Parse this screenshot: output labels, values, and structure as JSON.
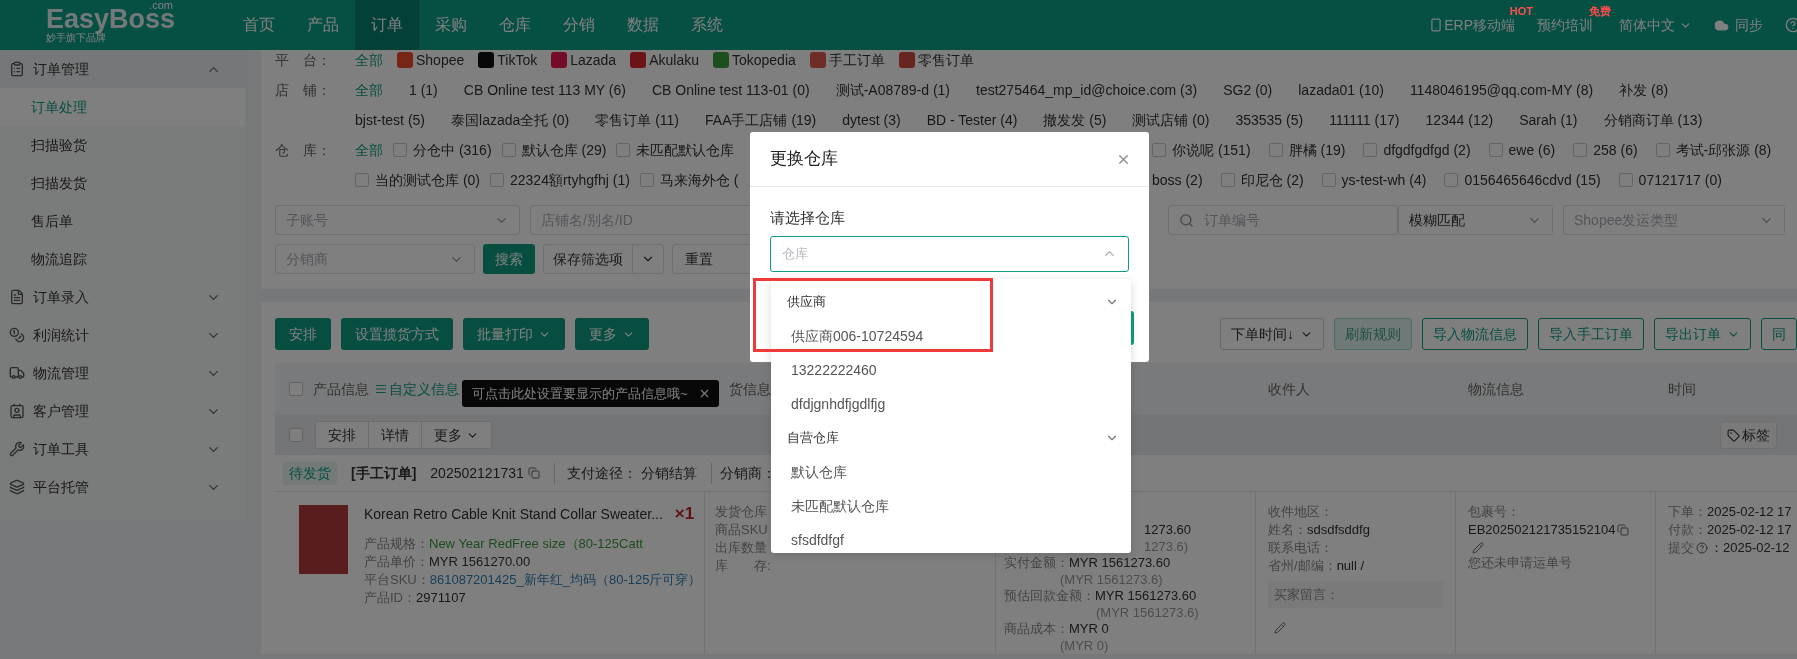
{
  "header": {
    "logo": "EasyBoss",
    "logo_domain": ".com",
    "tagline": "妙手旗下品牌",
    "nav": [
      {
        "label": "首页",
        "selected": false
      },
      {
        "label": "产品",
        "selected": false
      },
      {
        "label": "订单",
        "selected": true
      },
      {
        "label": "采购",
        "selected": false
      },
      {
        "label": "仓库",
        "selected": false
      },
      {
        "label": "分销",
        "selected": false
      },
      {
        "label": "数据",
        "selected": false
      },
      {
        "label": "系统",
        "selected": false
      }
    ],
    "tools": [
      {
        "kind": "mobile",
        "label": "ERP移动端",
        "badge": "HOT"
      },
      {
        "kind": "training",
        "label": "预约培训",
        "badge": "免费"
      },
      {
        "kind": "language",
        "label": "简体中文"
      },
      {
        "kind": "sync",
        "label": "同步"
      },
      {
        "kind": "help"
      }
    ]
  },
  "sidebar": [
    {
      "label": "订单管理",
      "expanded": true,
      "children": [
        {
          "label": "订单处理",
          "selected": true
        },
        {
          "label": "扫描验货",
          "selected": false
        },
        {
          "label": "扫描发货",
          "selected": false
        },
        {
          "label": "售后单",
          "selected": false
        },
        {
          "label": "物流追踪",
          "selected": false
        }
      ]
    },
    {
      "label": "订单录入",
      "expanded": false
    },
    {
      "label": "利润统计",
      "expanded": false
    },
    {
      "label": "物流管理",
      "expanded": false
    },
    {
      "label": "客户管理",
      "expanded": false
    },
    {
      "label": "订单工具",
      "expanded": false
    },
    {
      "label": "平台托管",
      "expanded": false
    }
  ],
  "filters": {
    "platform": {
      "label": "平　台：",
      "options": [
        {
          "label": "全部",
          "selected": true
        },
        {
          "label": "Shopee",
          "selected": false
        },
        {
          "label": "TikTok",
          "selected": false
        },
        {
          "label": "Lazada",
          "selected": false
        },
        {
          "label": "Akulaku",
          "selected": false
        },
        {
          "label": "Tokopedia",
          "selected": false
        },
        {
          "label": "手工订单",
          "selected": false
        },
        {
          "label": "零售订单",
          "selected": false
        }
      ]
    },
    "shop": {
      "label": "店　铺：",
      "options": [
        {
          "label": "全部",
          "selected": true
        },
        {
          "label": "1 (1)",
          "selected": false
        },
        {
          "label": "CB Online test 113 MY (6)",
          "selected": false
        },
        {
          "label": "CB Online test 113-01 (0)",
          "selected": false
        },
        {
          "label": "测试-A08789-d (1)",
          "selected": false
        },
        {
          "label": "test275464_mp_id@choice.com (3)",
          "selected": false
        },
        {
          "label": "SG2 (0)",
          "selected": false
        },
        {
          "label": "lazada01 (10)",
          "selected": false
        },
        {
          "label": "1148046195@qq.com-MY (8)",
          "selected": false
        },
        {
          "label": "补发 (8)",
          "selected": false
        },
        {
          "label": "bjst-test (5)",
          "selected": false
        },
        {
          "label": "泰国lazada全托 (0)",
          "selected": false
        },
        {
          "label": "零售订单 (11)",
          "selected": false
        },
        {
          "label": "FAA手工店铺 (19)",
          "selected": false
        },
        {
          "label": "dytest (3)",
          "selected": false
        },
        {
          "label": "BD - Tester (4)",
          "selected": false
        },
        {
          "label": "撤发发 (5)",
          "selected": false
        },
        {
          "label": "测试店铺 (0)",
          "selected": false
        },
        {
          "label": "353535 (5)",
          "selected": false
        },
        {
          "label": "111111 (17)",
          "selected": false
        },
        {
          "label": "12344 (12)",
          "selected": false
        },
        {
          "label": "Sarah (1)",
          "selected": false
        },
        {
          "label": "分销商订单 (13)",
          "selected": false
        }
      ]
    },
    "warehouse": {
      "label": "仓　库：",
      "all": {
        "label": "全部",
        "selected": true
      },
      "rows": [
        {
          "left": [
            {
              "label": "分仓中 (316)",
              "checked": false
            },
            {
              "label": "默认仓库 (29)",
              "checked": false
            },
            {
              "label": "未匹配默认仓库",
              "checked": false
            }
          ],
          "right": [
            {
              "label": "你说呢 (151)",
              "checked": false
            },
            {
              "label": "胖橘 (19)",
              "checked": false
            },
            {
              "label": "dfgdfgdfgd (2)",
              "checked": false
            },
            {
              "label": "ewe (6)",
              "checked": false
            },
            {
              "label": "258 (6)",
              "checked": false
            },
            {
              "label": "考试-邱张源 (8)",
              "checked": false
            }
          ]
        },
        {
          "left": [
            {
              "label": "当的测试仓库 (0)",
              "checked": false
            },
            {
              "label": "22324額rtyhgfhj (1)",
              "checked": false
            },
            {
              "label": "马来海外仓 (",
              "checked": false
            }
          ],
          "right_cut": "boss (2)",
          "right": [
            {
              "label": "印尼仓 (2)",
              "checked": false
            },
            {
              "label": "ys-test-wh (4)",
              "checked": false
            },
            {
              "label": "0156465646cdvd (15)",
              "checked": false
            },
            {
              "label": "07121717 (0)",
              "checked": false
            }
          ]
        }
      ]
    },
    "fields_left": [
      {
        "kind": "select",
        "placeholder": "子账号"
      },
      {
        "kind": "input",
        "placeholder": "店铺名/别名/ID"
      }
    ],
    "fields_right": [
      {
        "kind": "search",
        "placeholder": "订单编号"
      },
      {
        "kind": "select",
        "value": "模糊匹配"
      },
      {
        "kind": "select",
        "placeholder": "Shopee发运类型"
      }
    ],
    "distributor": {
      "placeholder": "分销商"
    },
    "search_button": "搜索",
    "save_button": "保存筛选项",
    "reset_button": "重置"
  },
  "toolbar": {
    "left": [
      {
        "label": "安排",
        "caret": false
      },
      {
        "label": "设置揽货方式",
        "caret": false
      },
      {
        "label": "批量打印",
        "caret": true
      },
      {
        "label": "更多",
        "caret": true
      }
    ],
    "right": [
      {
        "kind": "sort",
        "label": "下单时间↓",
        "disabled": false,
        "caret": true
      },
      {
        "kind": "button",
        "label": "刷新规则",
        "disabled": true,
        "caret": false
      },
      {
        "kind": "button",
        "label": "导入物流信息",
        "disabled": false,
        "caret": false
      },
      {
        "kind": "button",
        "label": "导入手工订单",
        "disabled": false,
        "caret": false
      },
      {
        "kind": "button",
        "label": "导出订单",
        "disabled": false,
        "caret": true
      },
      {
        "kind": "button",
        "label": "同",
        "disabled": false,
        "caret": false
      }
    ]
  },
  "table": {
    "select_all_checked": false,
    "product_column": "产品信息",
    "customize_link": "自定义信息",
    "tooltip": "可点击此处设置要显示的产品信息哦~",
    "shipping_column": "货信息",
    "recipient_column": "收件人",
    "logistics_column": "物流信息",
    "time_column": "时间",
    "batch_checked": false,
    "row_actions": [
      {
        "label": "安排",
        "caret": false
      },
      {
        "label": "详情",
        "caret": false
      },
      {
        "label": "更多",
        "caret": true
      }
    ],
    "tag_button": "标签",
    "order": {
      "status": "待发货",
      "source": "[手工订单]",
      "order_no": "202502121731",
      "payment_label": "支付途径：",
      "payment": "分销结算",
      "distributor_label": "分销商：",
      "product": {
        "title": "Korean Retro Cable Knit Stand Collar Sweater...",
        "quantity": "×1",
        "spec_label": "产品规格：",
        "spec": "New Year RedFree size（80-125Catt",
        "price_label": "产品单价：",
        "price": "MYR 1561270.00",
        "sku_label": "平台SKU：",
        "sku": "861087201425_新年红_均码（80-125斤可穿）",
        "id_label": "产品ID：",
        "id": "2971107"
      },
      "shipping": [
        "发货仓库",
        "商品SKU",
        "出库数量",
        "库　　存:"
      ],
      "amount_fragments": [
        "1273.60",
        "1273.6)"
      ],
      "amounts": [
        {
          "label": "实付金额：",
          "value": "MYR 1561273.60",
          "original": "(MYR 1561273.6)"
        },
        {
          "label": "预估回款金额：",
          "value": "MYR 1561273.60",
          "original": "(MYR 1561273.6)"
        },
        {
          "label": "商品成本：",
          "value": "MYR 0",
          "original": "(MYR 0)"
        }
      ],
      "recipient": {
        "region_label": "收件地区：",
        "name_label": "姓名：",
        "name": "sdsdfsddfg",
        "phone_label": "联系电话：",
        "postal_label": "省州/邮编：",
        "postal": "null /",
        "note_label": "买家留言："
      },
      "logistics": {
        "package_label": "包裹号：",
        "package_no": "EB202502121735152104",
        "status": "您还未申请运单号"
      },
      "times": [
        {
          "label": "下单：",
          "value": "2025-02-12 17",
          "help": false
        },
        {
          "label": "付款：",
          "value": "2025-02-12 17",
          "help": false
        },
        {
          "label": "提交",
          "value": "：2025-02-12",
          "help": true
        }
      ]
    }
  },
  "modal": {
    "title": "更换仓库",
    "field_label": "请选择仓库",
    "placeholder": "仓库",
    "open": true,
    "groups": [
      {
        "label": "供应商",
        "options": [
          "供应商006-10724594",
          "13222222460",
          "dfdjgnhdfjgdlfjg"
        ]
      },
      {
        "label": "自营仓库",
        "options": [
          "默认仓库",
          "未匹配默认仓库",
          "sfsdfdfgf"
        ]
      }
    ]
  }
}
